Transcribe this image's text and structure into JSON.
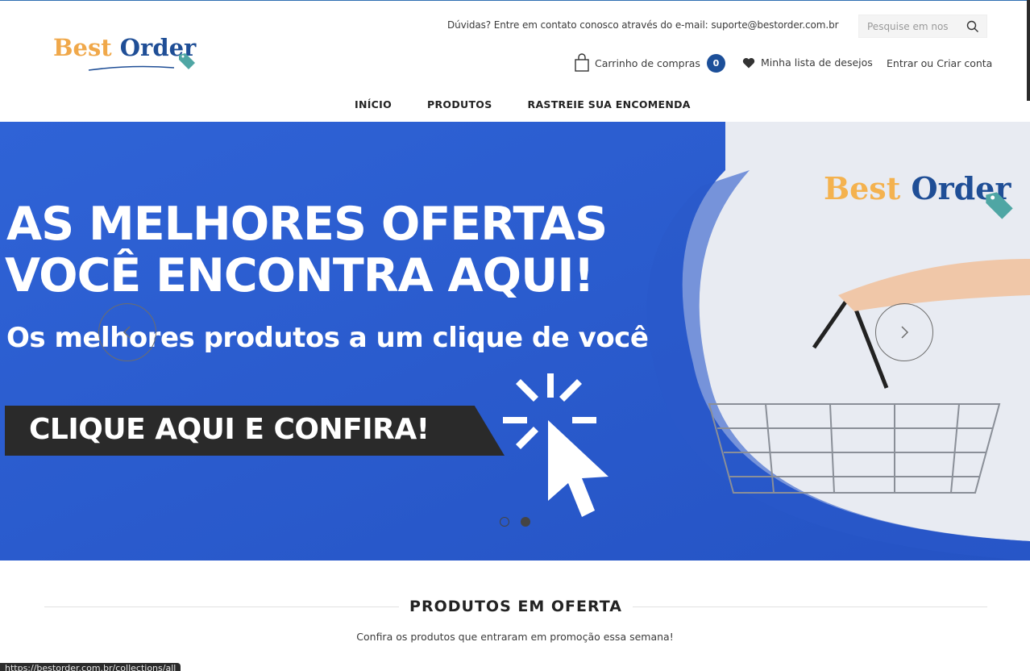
{
  "header": {
    "logo": {
      "part1": "Best",
      "part2": " Order"
    },
    "contact_text": "Dúvidas? Entre em contato conosco através do e-mail: suporte@bestorder.com.br",
    "search": {
      "placeholder": "Pesquise em nos"
    },
    "cart": {
      "label": "Carrinho de compras",
      "count": "0"
    },
    "wishlist": {
      "label": "Minha lista de desejos"
    },
    "account": {
      "login": "Entrar",
      "separator": " ou ",
      "register": "Criar conta"
    }
  },
  "nav": {
    "items": [
      {
        "label": "INÍCIO"
      },
      {
        "label": "PRODUTOS"
      },
      {
        "label": "RASTREIE SUA ENCOMENDA"
      }
    ]
  },
  "hero": {
    "line1": "AS MELHORES OFERTAS",
    "line2": "VOCÊ ENCONTRA AQUI!",
    "subtitle": "Os melhores produtos a um clique de você",
    "cta": "CLIQUE AQUI E CONFIRA!",
    "logo": {
      "part1": "Best",
      "part2": " Order"
    },
    "slides_total": 2,
    "active_slide": 2
  },
  "section": {
    "title": "PRODUTOS EM OFERTA",
    "subtitle": "Confira os produtos que entraram em promoção essa semana!"
  },
  "status_bar": {
    "url": "https://bestorder.com.br/collections/all"
  },
  "colors": {
    "brand_blue": "#1c4f99",
    "brand_orange": "#f0a84a",
    "hero_blue": "#2d5ed1",
    "tag_teal": "#4fa6a4"
  }
}
